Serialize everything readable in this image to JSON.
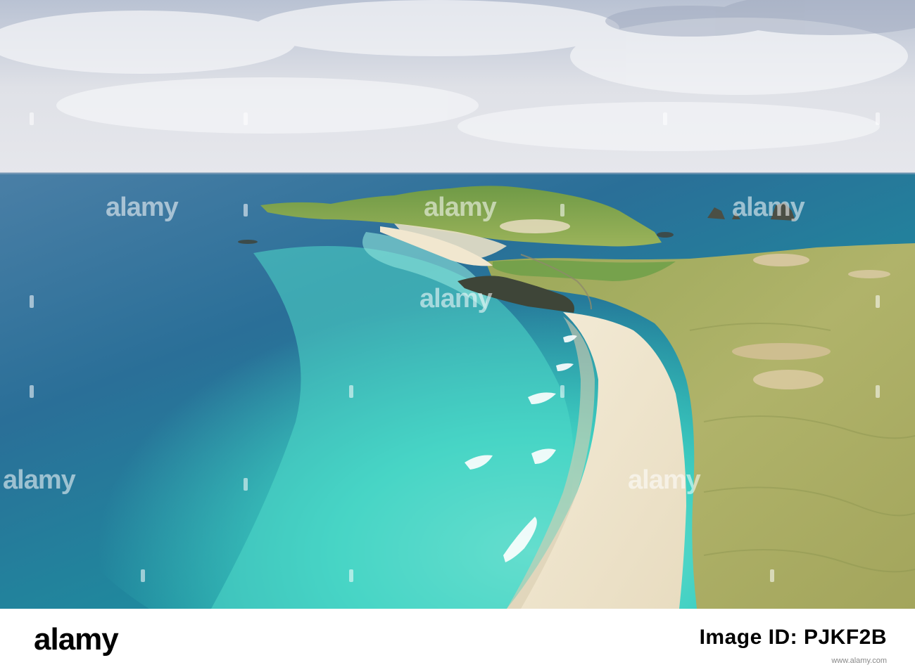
{
  "photo": {
    "subject": "aerial coastal beach with turquoise sea and dunes",
    "colors": {
      "sky": "#d9dce3",
      "sea_deep": "#2f6f9a",
      "sea_turquoise": "#3fd0c2",
      "sand": "#f0e6cf",
      "grass": "#a6b05a",
      "green_headland": "#7fa84a"
    }
  },
  "watermark": {
    "text": "alamy"
  },
  "footer": {
    "logo": "alamy",
    "image_id_label": "Image ID: PJKF2B",
    "url": "www.alamy.com"
  }
}
